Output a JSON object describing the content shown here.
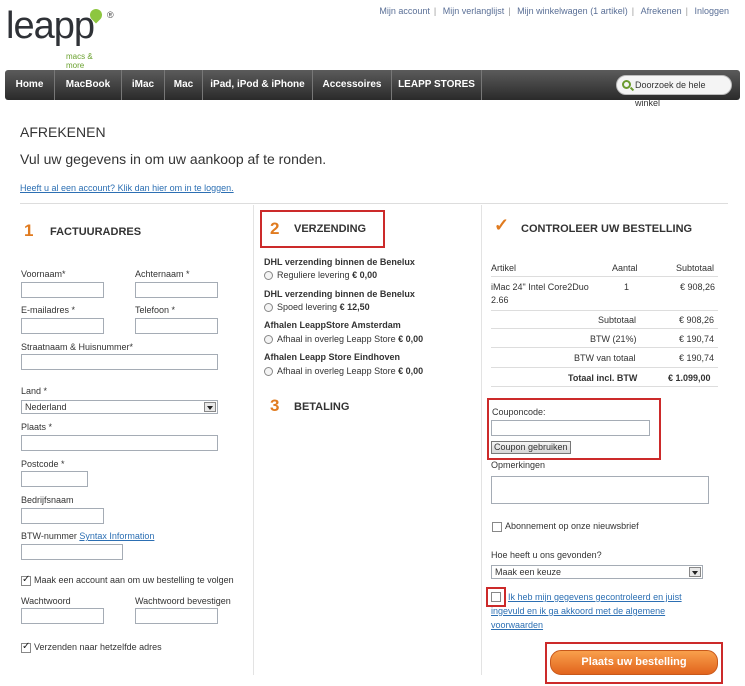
{
  "brand": {
    "name": "leapp",
    "tagline": "macs & more",
    "reg": "®"
  },
  "toplinks": [
    "Mijn account",
    "Mijn verlanglijst",
    "Mijn winkelwagen (1 artikel)",
    "Afrekenen",
    "Inloggen"
  ],
  "nav": {
    "items": [
      "Home",
      "MacBook",
      "iMac",
      "Mac",
      "iPad, iPod & iPhone",
      "Accessoires",
      "LEAPP STORES"
    ],
    "search_label": "Doorzoek de hele winkel"
  },
  "page": {
    "title": "AFREKENEN",
    "subtitle": "Vul uw gegevens in om uw aankoop af te ronden.",
    "login_link": "Heeft u al een account? Klik dan hier om in te loggen."
  },
  "billing": {
    "step": "1",
    "title": "FACTUURADRES",
    "firstname": "Voornaam*",
    "lastname": "Achternaam *",
    "email": "E-mailadres *",
    "phone": "Telefoon *",
    "street": "Straatnaam & Huisnummer*",
    "country_label": "Land *",
    "country_value": "Nederland",
    "city": "Plaats *",
    "postcode": "Postcode *",
    "company": "Bedrijfsnaam",
    "vat_label": "BTW-nummer",
    "vat_link": "Syntax Information",
    "create_account": "Maak een account aan om uw bestelling te volgen",
    "password": "Wachtwoord",
    "password_confirm": "Wachtwoord bevestigen",
    "same_address": "Verzenden naar hetzelfde adres"
  },
  "shipping": {
    "step": "2",
    "title": "VERZENDING",
    "methods": [
      {
        "title": "DHL verzending binnen de Benelux",
        "option": "Reguliere levering",
        "price": "€ 0,00"
      },
      {
        "title": "DHL verzending binnen de Benelux",
        "option": "Spoed levering",
        "price": "€ 12,50"
      },
      {
        "title": "Afhalen LeappStore Amsterdam",
        "option": "Afhaal in overleg Leapp Store",
        "price": "€ 0,00"
      },
      {
        "title": "Afhalen Leapp Store Eindhoven",
        "option": "Afhaal in overleg Leapp Store",
        "price": "€ 0,00"
      }
    ]
  },
  "payment": {
    "step": "3",
    "title": "BETALING"
  },
  "review": {
    "title": "CONTROLEER UW BESTELLING",
    "headers": {
      "article": "Artikel",
      "qty": "Aantal",
      "subtotal": "Subtotaal"
    },
    "item": {
      "name_line1": "iMac 24\" Intel Core2Duo",
      "name_line2": "2.66",
      "qty": "1",
      "price": "€ 908,26"
    },
    "totals": [
      {
        "label": "Subtotaal",
        "value": "€ 908,26"
      },
      {
        "label": "BTW (21%)",
        "value": "€ 190,74"
      },
      {
        "label": "BTW van totaal",
        "value": "€ 190,74"
      }
    ],
    "grand_total": {
      "label": "Totaal incl. BTW",
      "value": "€ 1.099,00"
    },
    "coupon_label": "Couponcode:",
    "coupon_button": "Coupon gebruiken",
    "remarks_label": "Opmerkingen",
    "newsletter": "Abonnement op onze nieuwsbrief",
    "found_label": "Hoe heeft u ons gevonden?",
    "found_value": "Maak een keuze",
    "terms_line1": "Ik heb mijn gegevens gecontroleerd en juist",
    "terms_line2": "ingevuld en ik ga akkoord met de algemene",
    "terms_line3": "voorwaarden",
    "place_order": "Plaats uw bestelling"
  },
  "colors": {
    "accent": "#e07b20",
    "link": "#2c6fb3",
    "highlight": "#cc2a2a",
    "brand_green": "#8dc63f"
  }
}
